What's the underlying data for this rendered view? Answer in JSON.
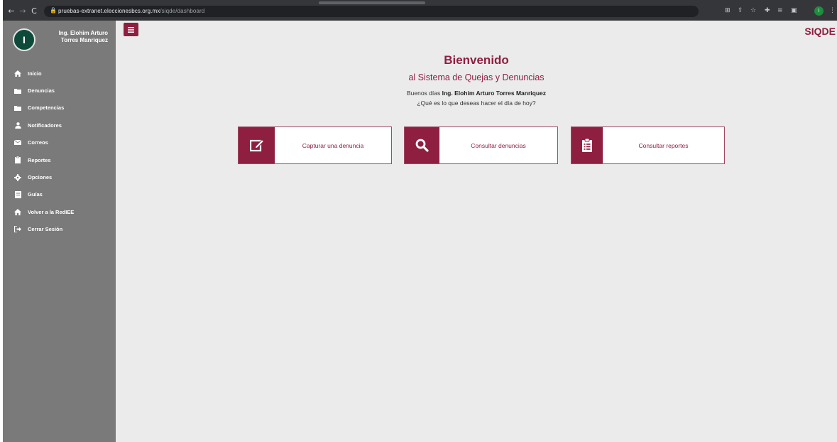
{
  "browser": {
    "url_domain": "pruebas-extranet.eleccionesbcs.org.mx",
    "url_path": "/siqde/dashboard",
    "profile_initial": "I"
  },
  "sidebar": {
    "avatar_initial": "I",
    "user_name_line1": "Ing. Elohim Arturo",
    "user_name_line2": "Torres Manriquez",
    "items": [
      {
        "label": "Inicio",
        "icon": "home-icon"
      },
      {
        "label": "Denuncias",
        "icon": "folder-icon"
      },
      {
        "label": "Competencias",
        "icon": "folder-icon"
      },
      {
        "label": "Notificadores",
        "icon": "user-icon"
      },
      {
        "label": "Correos",
        "icon": "envelope-icon"
      },
      {
        "label": "Reportes",
        "icon": "clipboard-icon"
      },
      {
        "label": "Opciones",
        "icon": "gear-icon"
      },
      {
        "label": "Guías",
        "icon": "book-icon"
      },
      {
        "label": "Volver a la RedIEE",
        "icon": "home-icon"
      },
      {
        "label": "Cerrar Sesión",
        "icon": "logout-icon"
      }
    ]
  },
  "header": {
    "brand": "SIQDE"
  },
  "welcome": {
    "title": "Bienvenido",
    "subtitle": "al Sistema de Quejas y Denuncias",
    "greeting_prefix": "Buenos días",
    "user_full_name": "Ing. Elohim Arturo Torres Manriquez",
    "question": "¿Qué es lo que deseas hacer el día de hoy?"
  },
  "actions": [
    {
      "label": "Capturar una denuncia",
      "icon": "edit-icon"
    },
    {
      "label": "Consultar denuncias",
      "icon": "search-icon"
    },
    {
      "label": "Consultar reportes",
      "icon": "clipboard-list-icon"
    }
  ],
  "colors": {
    "brand": "#8e1f41",
    "sidebar": "#7a7a7a",
    "content_bg": "#ebebeb",
    "avatar_bg": "#0d4a3a"
  }
}
